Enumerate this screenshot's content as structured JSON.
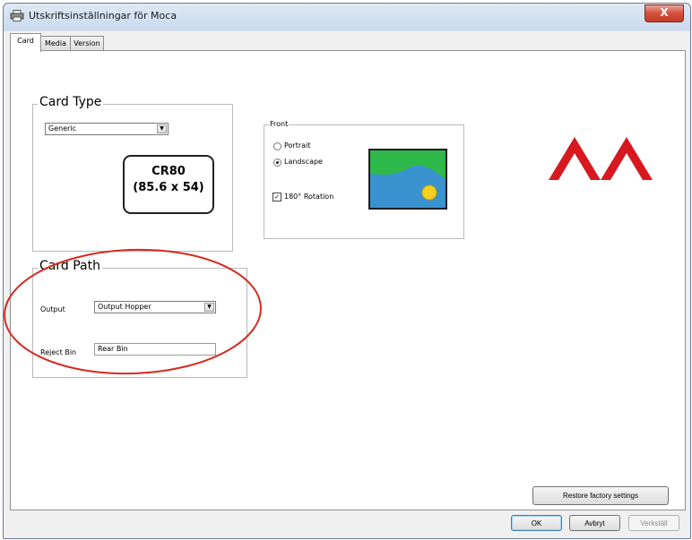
{
  "window": {
    "title": "Utskriftsinställningar för Moca",
    "close_label": "X"
  },
  "tabs": [
    {
      "label": "Card",
      "active": true
    },
    {
      "label": "Media",
      "active": false
    },
    {
      "label": "Version",
      "active": false
    }
  ],
  "card_type": {
    "legend": "Card Type",
    "selected": "Generic",
    "card_line1": "CR80",
    "card_line2": "(85.6 x 54)"
  },
  "front": {
    "legend": "Front",
    "portrait_label": "Portrait",
    "landscape_label": "Landscape",
    "selected_orientation": "Landscape",
    "rotation_label": "180° Rotation",
    "rotation_checked": true,
    "check_mark": "✓"
  },
  "card_path": {
    "legend": "Card Path",
    "output_label": "Output",
    "output_selected": "Output Hopper",
    "reject_label": "Reject Bin",
    "reject_value": "Rear Bin"
  },
  "buttons": {
    "restore": "Restore factory settings",
    "ok": "OK",
    "cancel": "Avbryt",
    "apply": "Verkställ"
  },
  "colors": {
    "logo_red": "#d7181f",
    "highlight_red": "#d42a20",
    "preview_sky": "#3a92cf",
    "preview_land": "#2fb84a",
    "preview_sun": "#f4d020"
  },
  "icons": {
    "title_icon": "printer-icon",
    "dropdown_arrow": "▼",
    "logo": "moca-logo"
  }
}
